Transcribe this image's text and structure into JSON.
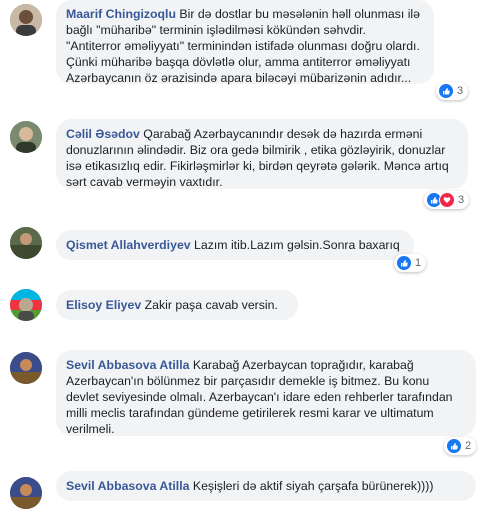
{
  "comments": [
    {
      "author": "Maarif Chingizoqlu",
      "text": " Bir də dostlar bu məsələnin həll olunması ilə bağlı \"müharibə\" terminin işlədilməsi kökündən səhvdir. \"Antiterror əməliyyatı\" terminindən istifadə olunması doğru olardı. Çünki müharibə başqa dövlətlə olur, amma antiterror əməliyyatı Azərbaycanın öz ərazisində apara biləcəyi mübarizənin adıdır...",
      "reactions": "3"
    },
    {
      "author": "Cəlil Əsədov",
      "text": " Qarabağ Azərbaycanındır desək də hazırda ermәni donuzlarının əlindədir. Biz ora gedə bilmirik , etika gözləyirik, donuzlar isə etikasızlıq edir. Fikirləşmirlər ki, birdən qeyrətə gələrik. Məncə artıq sərt cavab verməyin vaxtıdır.",
      "reactions": "3"
    },
    {
      "author": "Qismet Allahverdiyev",
      "text": " Lazım itib.Lazım gəlsin.Sonra baxarıq",
      "reactions": "1"
    },
    {
      "author": "Elisoy Eliyev",
      "text": " Zakir paşa cavab versin.",
      "reactions": ""
    },
    {
      "author": "Sevil Abbasova Atilla",
      "text": " Karabağ Azerbaycan toprağıdır, karabağ Azerbaycan'ın bölünmez bir parçasıdır demekle iş bitmez. Bu konu devlet seviyesinde olmalı. Azerbaycan'ı idare eden rehberler tarafından milli meclis tarafından gündeme getirilerek resmi karar ve ultimatum verilmeli.",
      "reactions": "2"
    },
    {
      "author": "Sevil Abbasova Atilla",
      "text": " Keşişleri də aktif siyah çarşafa bürünerek))))",
      "reactions": ""
    }
  ],
  "colors": {
    "author": "#385898",
    "bubble": "#f2f3f5",
    "like": "#1877f2",
    "love": "#f0284a"
  }
}
